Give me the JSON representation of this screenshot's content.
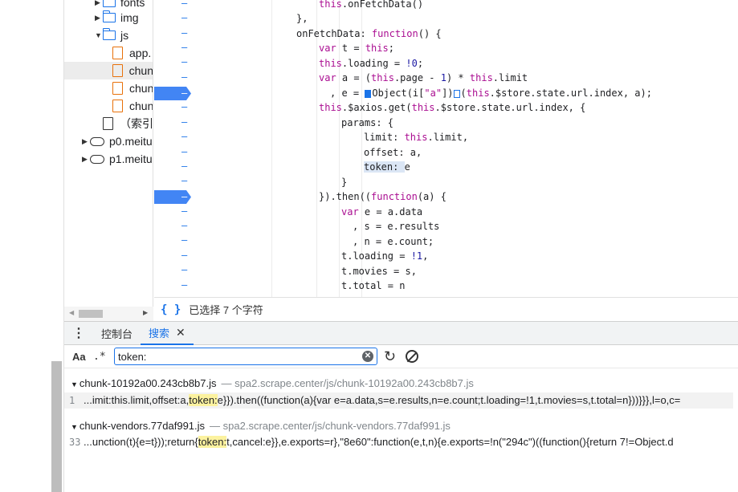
{
  "file_tree": {
    "items": [
      {
        "type": "folder",
        "label": "fonts",
        "expanded": false
      },
      {
        "type": "folder",
        "label": "img",
        "expanded": false
      },
      {
        "type": "folder",
        "label": "js",
        "expanded": true
      },
      {
        "type": "file",
        "label": "app."
      },
      {
        "type": "file",
        "label": "chun"
      },
      {
        "type": "file",
        "label": "chun"
      },
      {
        "type": "file",
        "label": "chun"
      },
      {
        "type": "doc",
        "label": "（索引"
      },
      {
        "type": "cloud",
        "label": "p0.meitu"
      },
      {
        "type": "cloud",
        "label": "p1.meitu"
      }
    ]
  },
  "code": {
    "lines": [
      "this.onFetchData()",
      "},",
      "onFetchData: function() {",
      "var t = this;",
      "this.loading = !0;",
      "var a = (this.page - 1) * this.limit",
      ", e = Object(i[\"a\"])(this.$store.state.url.index, a);",
      "this.$axios.get(this.$store.state.url.index, {",
      "params: {",
      "limit: this.limit,",
      "offset: a,",
      "token: e",
      "}",
      "}).then((function(a) {",
      "var e = a.data",
      ", s = e.results",
      ", n = e.count;",
      "t.loading = !1,",
      "t.movies = s,",
      "t.total = n"
    ],
    "breakpoint_marker": "–"
  },
  "status_bar": {
    "braces": "{ }",
    "text": "已选择 7 个字符"
  },
  "drawer": {
    "tabs": [
      {
        "label": "控制台",
        "active": false
      },
      {
        "label": "搜索",
        "active": true
      }
    ]
  },
  "search": {
    "case_label": "Aa",
    "regex_label": ".*",
    "query": "token:"
  },
  "results": [
    {
      "file": "chunk-10192a00.243cb8b7.js",
      "path": "spa2.scrape.center/js/chunk-10192a00.243cb8b7.js",
      "line": "1",
      "before": "...imit:this.limit,offset:a,",
      "match": "token:",
      "after": "e}}).then((function(a){var e=a.data,s=e.results,n=e.count;t.loading=!1,t.movies=s,t.total=n}))}}},l=o,c="
    },
    {
      "file": "chunk-vendors.77daf991.js",
      "path": "spa2.scrape.center/js/chunk-vendors.77daf991.js",
      "line": "33",
      "before": "...unction(t){e=t}));return{",
      "match": "token:",
      "after": "t,cancel:e}},e.exports=r},\"8e60\":function(e,t,n){e.exports=!n(\"294c\")((function(){return 7!=Object.d"
    }
  ]
}
